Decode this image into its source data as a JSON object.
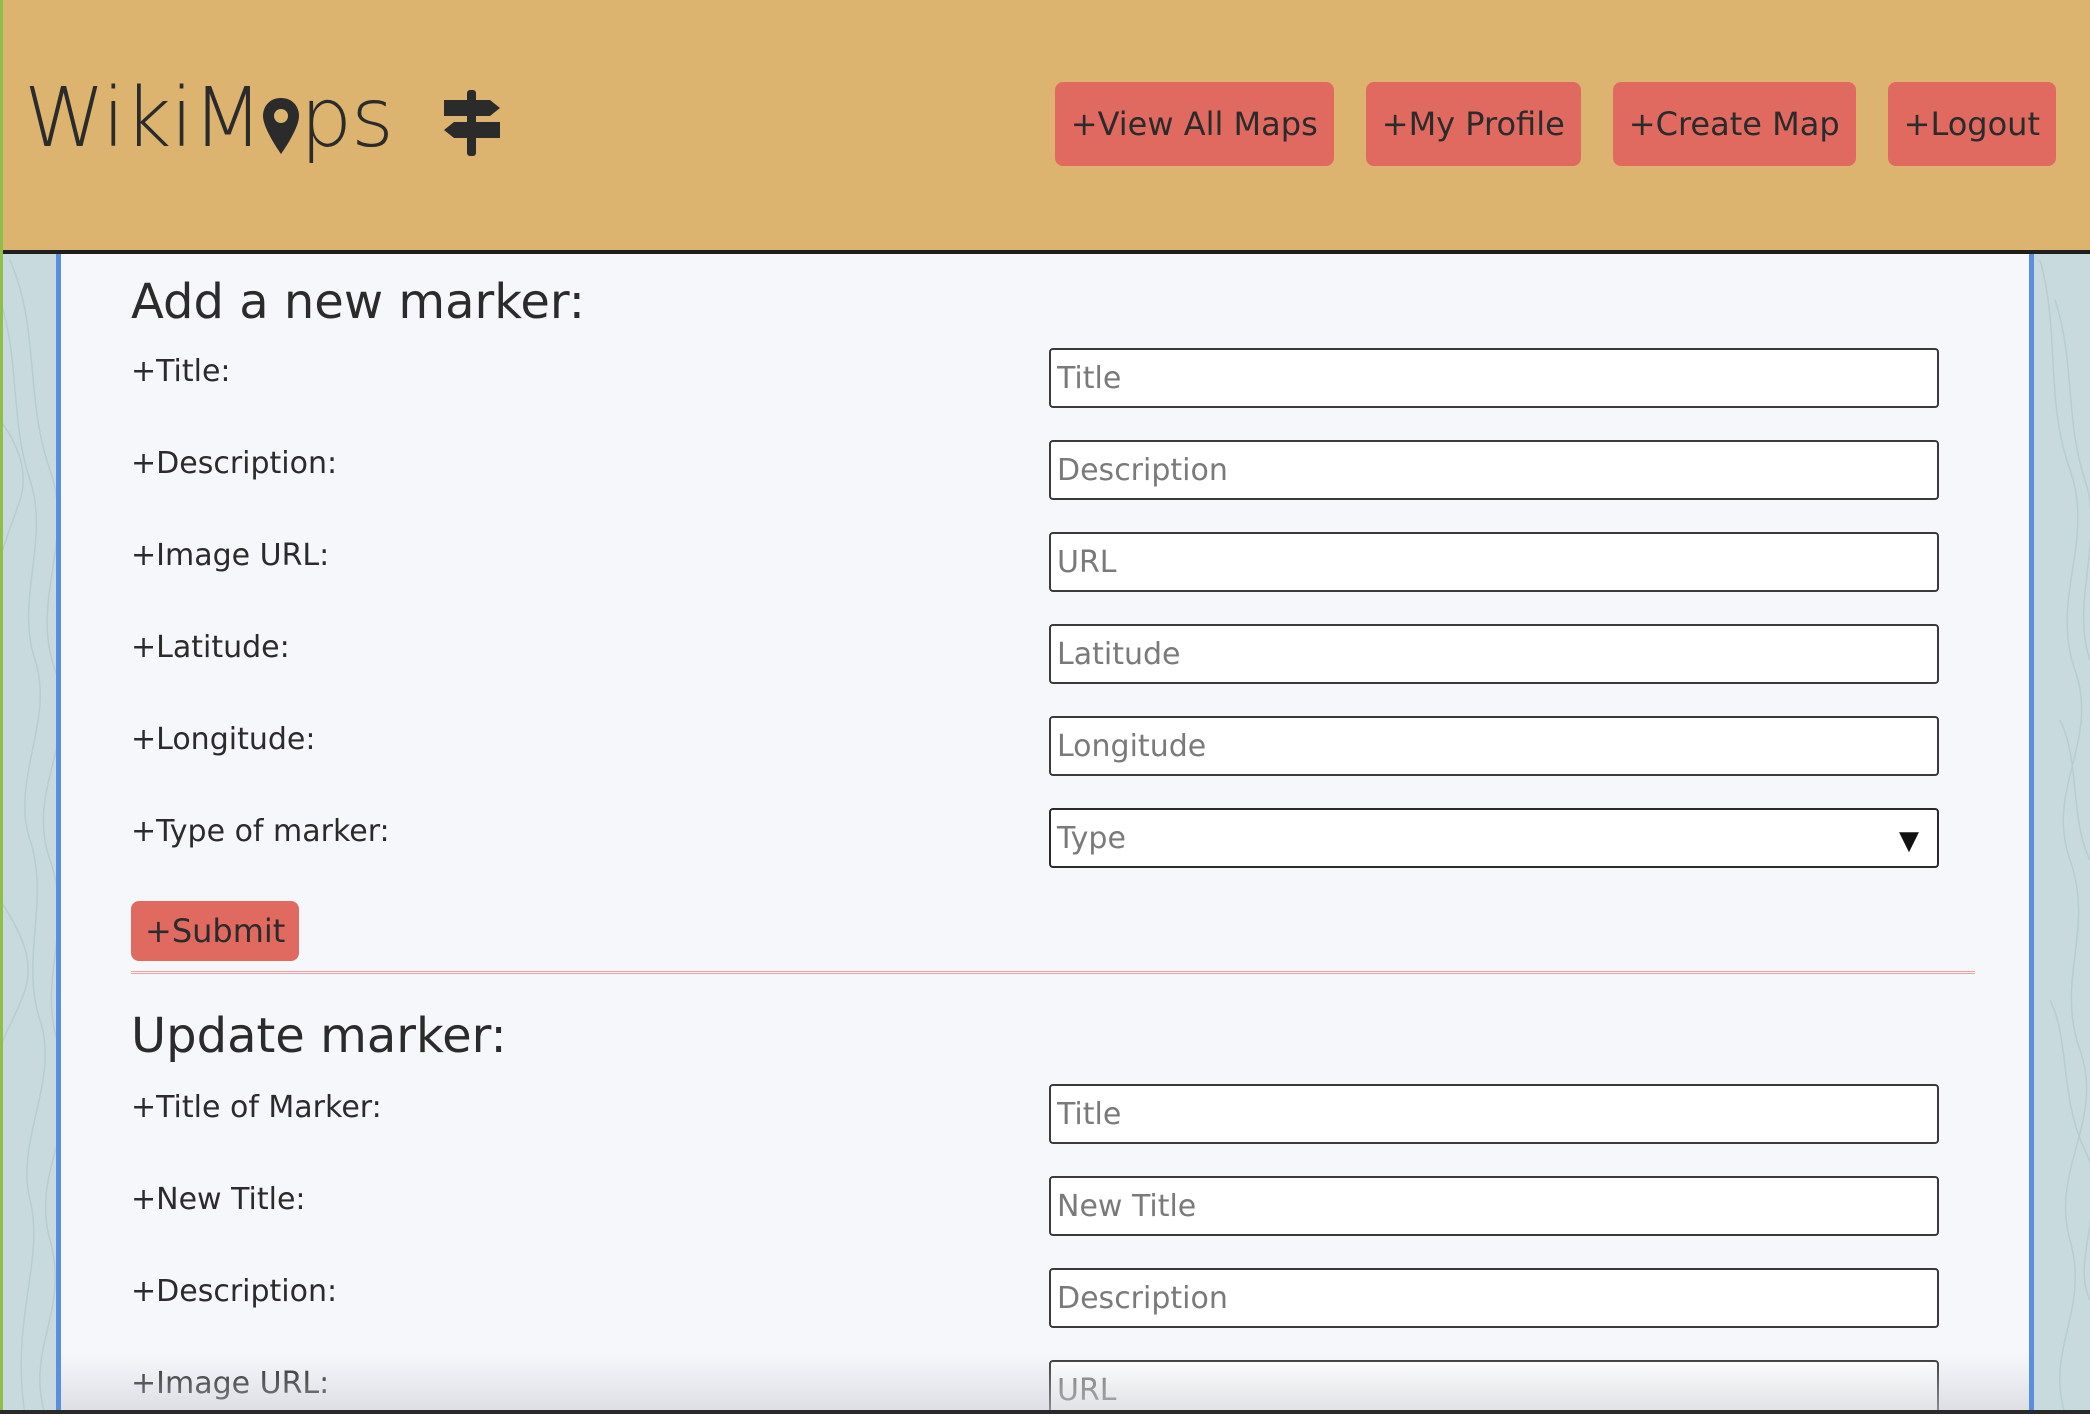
{
  "header": {
    "logo_left": "WikiM",
    "logo_right": "ps",
    "nav": [
      {
        "label": "+View All Maps"
      },
      {
        "label": "+My Profile"
      },
      {
        "label": "+Create Map"
      },
      {
        "label": "+Logout"
      }
    ]
  },
  "add_marker": {
    "title": "Add a new marker:",
    "fields": {
      "title": {
        "label": "+Title:",
        "placeholder": "Title"
      },
      "description": {
        "label": "+Description:",
        "placeholder": "Description"
      },
      "image_url": {
        "label": "+Image URL:",
        "placeholder": "URL"
      },
      "latitude": {
        "label": "+Latitude:",
        "placeholder": "Latitude"
      },
      "longitude": {
        "label": "+Longitude:",
        "placeholder": "Longitude"
      },
      "type": {
        "label": "+Type of marker:",
        "value": "Type"
      }
    },
    "submit_label": "+Submit"
  },
  "update_marker": {
    "title": "Update marker:",
    "fields": {
      "title_of_marker": {
        "label": "+Title of Marker:",
        "placeholder": "Title"
      },
      "new_title": {
        "label": "+New Title:",
        "placeholder": "New Title"
      },
      "description": {
        "label": "+Description:",
        "placeholder": "Description"
      },
      "image_url": {
        "label": "+Image URL:",
        "placeholder": "URL"
      }
    }
  },
  "icons": {
    "logo_pin": "map-pin-icon",
    "signpost": "signpost-icon",
    "dropdown": "dropdown-arrow-icon"
  },
  "colors": {
    "header_bg": "#dcb46f",
    "button_bg": "#e06a60",
    "panel_bg": "#f6f7fb",
    "panel_border": "#5a8fe0",
    "page_bg": "#c8dadd"
  }
}
